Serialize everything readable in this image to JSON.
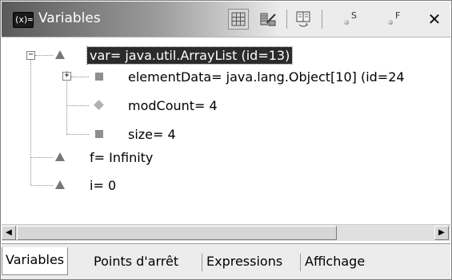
{
  "window": {
    "title": "Variables"
  },
  "toolbar": {
    "tools": [
      {
        "name": "show-type-names",
        "pressed": true
      },
      {
        "name": "show-logical-structure",
        "pressed": false
      },
      {
        "name": "toggle-detail-pane",
        "pressed": false
      },
      {
        "name": "show-static-variables",
        "letter": "S"
      },
      {
        "name": "show-final-variables",
        "letter": "F"
      }
    ],
    "close_glyph": "✕"
  },
  "tree": {
    "rows": [
      {
        "label": "var= java.util.ArrayList  (id=13)",
        "icon": "triangle",
        "expander": "−",
        "selected": true
      },
      {
        "label": "elementData= java.lang.Object[10]  (id=24",
        "icon": "square",
        "expander": "+",
        "selected": false
      },
      {
        "label": "modCount= 4",
        "icon": "diamond",
        "expander": "",
        "selected": false
      },
      {
        "label": "size= 4",
        "icon": "square",
        "expander": "",
        "selected": false
      },
      {
        "label": "f= Infinity",
        "icon": "triangle",
        "expander": "",
        "selected": false
      },
      {
        "label": "i= 0",
        "icon": "triangle",
        "expander": "",
        "selected": false
      }
    ]
  },
  "scrollbar": {
    "left_arrow": "◀",
    "right_arrow": "▶"
  },
  "tabs": [
    {
      "label": "Variables",
      "active": true
    },
    {
      "label": "Points d'arrêt",
      "active": false
    },
    {
      "label": "Expressions",
      "active": false
    },
    {
      "label": "Affichage",
      "active": false
    }
  ]
}
